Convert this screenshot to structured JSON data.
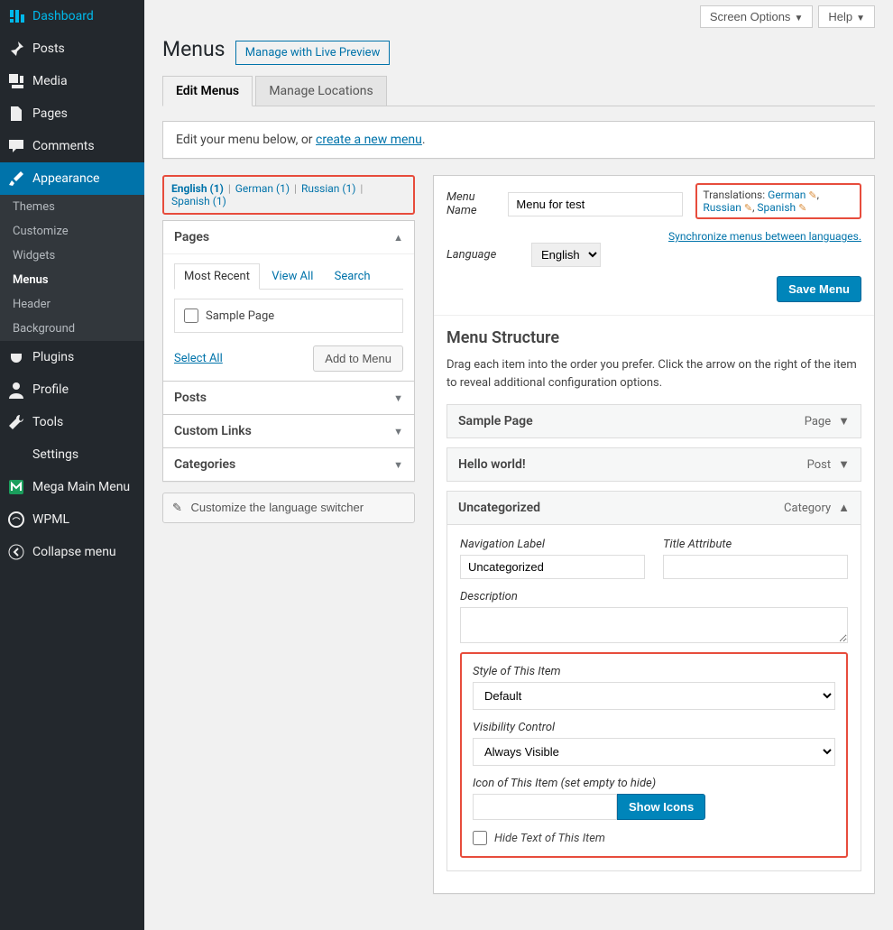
{
  "topbar": {
    "screen_options": "Screen Options",
    "help": "Help"
  },
  "page": {
    "title": "Menus",
    "manage_live": "Manage with Live Preview",
    "tabs": {
      "edit": "Edit Menus",
      "locations": "Manage Locations"
    },
    "notice_prefix": "Edit your menu below, or ",
    "notice_link": "create a new menu",
    "notice_suffix": "."
  },
  "sidebar": {
    "items": [
      {
        "label": "Dashboard",
        "icon": "dashboard"
      },
      {
        "label": "Posts",
        "icon": "pin"
      },
      {
        "label": "Media",
        "icon": "media"
      },
      {
        "label": "Pages",
        "icon": "pages"
      },
      {
        "label": "Comments",
        "icon": "comment"
      },
      {
        "label": "Appearance",
        "icon": "brush",
        "current": true
      },
      {
        "label": "Plugins",
        "icon": "plug"
      },
      {
        "label": "Profile",
        "icon": "user"
      },
      {
        "label": "Tools",
        "icon": "wrench"
      },
      {
        "label": "Settings",
        "icon": "sliders"
      },
      {
        "label": "Mega Main Menu",
        "icon": "mmm"
      },
      {
        "label": "WPML",
        "icon": "wpml"
      },
      {
        "label": "Collapse menu",
        "icon": "collapse"
      }
    ],
    "submenu": [
      {
        "label": "Themes"
      },
      {
        "label": "Customize"
      },
      {
        "label": "Widgets"
      },
      {
        "label": "Menus",
        "current": true
      },
      {
        "label": "Header"
      },
      {
        "label": "Background"
      }
    ]
  },
  "lang_filter": {
    "options": [
      "English (1)",
      "German (1)",
      "Russian (1)",
      "Spanish (1)"
    ],
    "active": 0
  },
  "accordion": {
    "pages": {
      "title": "Pages",
      "subtabs": [
        "Most Recent",
        "View All",
        "Search"
      ],
      "item": "Sample Page",
      "select_all": "Select All",
      "add": "Add to Menu"
    },
    "posts": "Posts",
    "custom": "Custom Links",
    "cats": "Categories"
  },
  "customize_switcher": "Customize the language switcher",
  "menu_settings": {
    "name_label": "Menu Name",
    "name_value": "Menu for test",
    "trans_label": "Translations:",
    "trans_langs": [
      "German",
      "Russian",
      "Spanish"
    ],
    "lang_label": "Language",
    "lang_value": "English",
    "sync": "Synchronize menus between languages.",
    "save": "Save Menu"
  },
  "structure": {
    "title": "Menu Structure",
    "desc": "Drag each item into the order you prefer. Click the arrow on the right of the item to reveal additional configuration options.",
    "items": [
      {
        "title": "Sample Page",
        "type": "Page"
      },
      {
        "title": "Hello world!",
        "type": "Post"
      },
      {
        "title": "Uncategorized",
        "type": "Category",
        "open": true
      }
    ],
    "open_item": {
      "nav_label": "Navigation Label",
      "nav_value": "Uncategorized",
      "title_attr": "Title Attribute",
      "title_value": "",
      "desc_label": "Description",
      "desc_value": "",
      "style_label": "Style of This Item",
      "style_value": "Default",
      "vis_label": "Visibility Control",
      "vis_value": "Always Visible",
      "icon_label": "Icon of This Item (set empty to hide)",
      "icon_value": "",
      "show_icons": "Show Icons",
      "hide_text": "Hide Text of This Item"
    }
  }
}
